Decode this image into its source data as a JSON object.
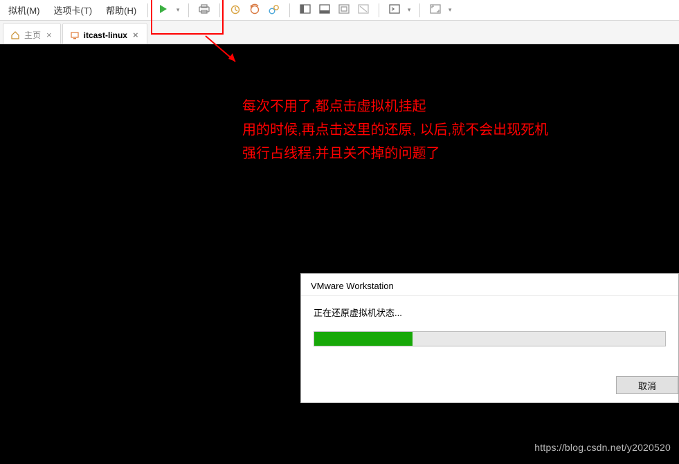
{
  "menu": {
    "vm": "拟机(M)",
    "tabs": "选项卡(T)",
    "help": "帮助(H)"
  },
  "icons": {
    "play": "play-icon",
    "dropdown": "chevron-down-icon",
    "print": "print-icon",
    "clock1": "snapshot-icon",
    "clock2": "snapshot-revert-icon",
    "clock3": "snapshot-manager-icon",
    "layout1": "split-left-icon",
    "layout2": "split-bottom-icon",
    "layout3": "fit-guest-icon",
    "layout4": "unity-icon",
    "console": "console-icon",
    "full": "fullscreen-icon"
  },
  "tabs_bar": [
    {
      "label": "主页",
      "icon": "home-icon",
      "active": false
    },
    {
      "label": "itcast-linux",
      "icon": "vm-icon",
      "active": true
    }
  ],
  "annotation": {
    "l1": "每次不用了,都点击虚拟机挂起",
    "l2": "用的时候,再点击这里的还原, 以后,就不会出现死机",
    "l3": "强行占线程,并且关不掉的问题了"
  },
  "dialog": {
    "title": "VMware Workstation",
    "status": "正在还原虚拟机状态...",
    "cancel": "取消"
  },
  "watermark": "https://blog.csdn.net/y2020520"
}
